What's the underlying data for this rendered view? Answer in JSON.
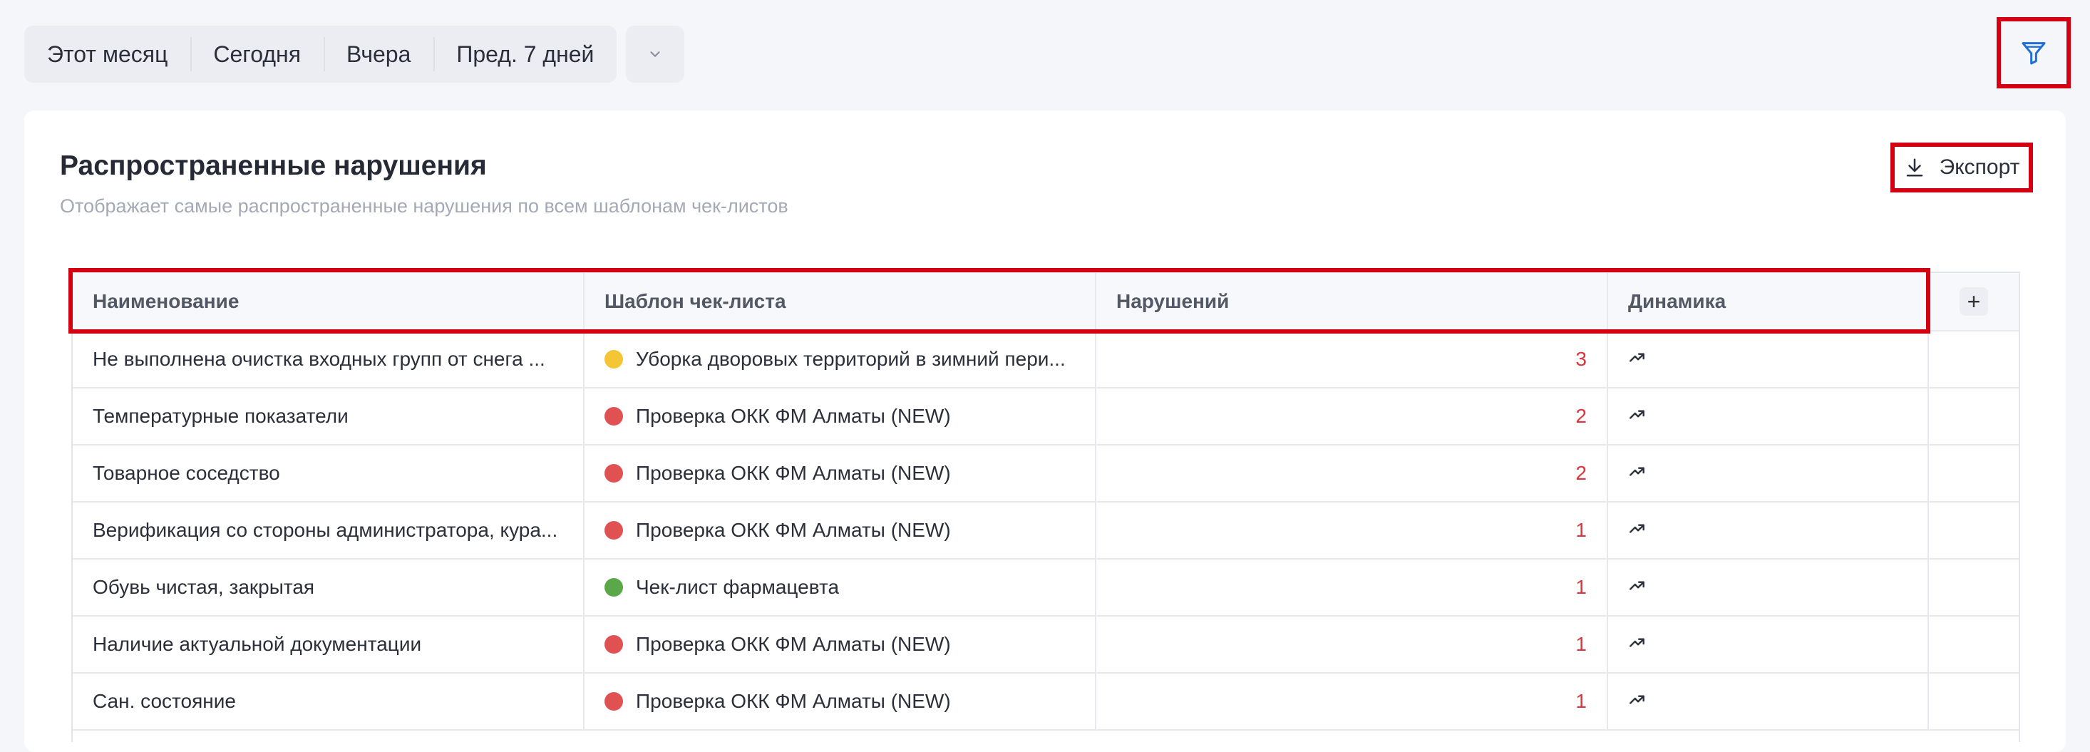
{
  "periods": [
    "Этот месяц",
    "Сегодня",
    "Вчера",
    "Пред. 7 дней"
  ],
  "icons": {
    "more": "chevron-down-icon",
    "filter": "filter-icon",
    "export": "download-icon",
    "trend": "trend-up-icon"
  },
  "colors": {
    "accent": "#1f6fd6",
    "highlight": "#d40012",
    "count": "#d9363e"
  },
  "card": {
    "title": "Распространенные нарушения",
    "subtitle": "Отображает самые распространенные нарушения по всем шаблонам чек-листов",
    "export_label": "Экспорт"
  },
  "table": {
    "columns": [
      "Наименование",
      "Шаблон чек-листа",
      "Нарушений",
      "Динамика"
    ],
    "add_column_label": "+",
    "rows": [
      {
        "name": "Не выполнена очистка входных групп от снега ...",
        "template": "Уборка дворовых территорий в зимний пери...",
        "template_color": "#f4c534",
        "count": "3"
      },
      {
        "name": "Температурные показатели",
        "template": "Проверка ОКК ФМ Алматы (NEW)",
        "template_color": "#e05252",
        "count": "2"
      },
      {
        "name": "Товарное соседство",
        "template": "Проверка ОКК ФМ Алматы (NEW)",
        "template_color": "#e05252",
        "count": "2"
      },
      {
        "name": "Верификация со стороны администратора, кура...",
        "template": "Проверка ОКК ФМ Алматы (NEW)",
        "template_color": "#e05252",
        "count": "1"
      },
      {
        "name": "Обувь чистая, закрытая",
        "template": "Чек-лист фармацевта",
        "template_color": "#5aa84a",
        "count": "1"
      },
      {
        "name": "Наличие актуальной документации",
        "template": "Проверка ОКК ФМ Алматы (NEW)",
        "template_color": "#e05252",
        "count": "1"
      },
      {
        "name": "Сан. состояние",
        "template": "Проверка ОКК ФМ Алматы (NEW)",
        "template_color": "#e05252",
        "count": "1"
      }
    ]
  }
}
